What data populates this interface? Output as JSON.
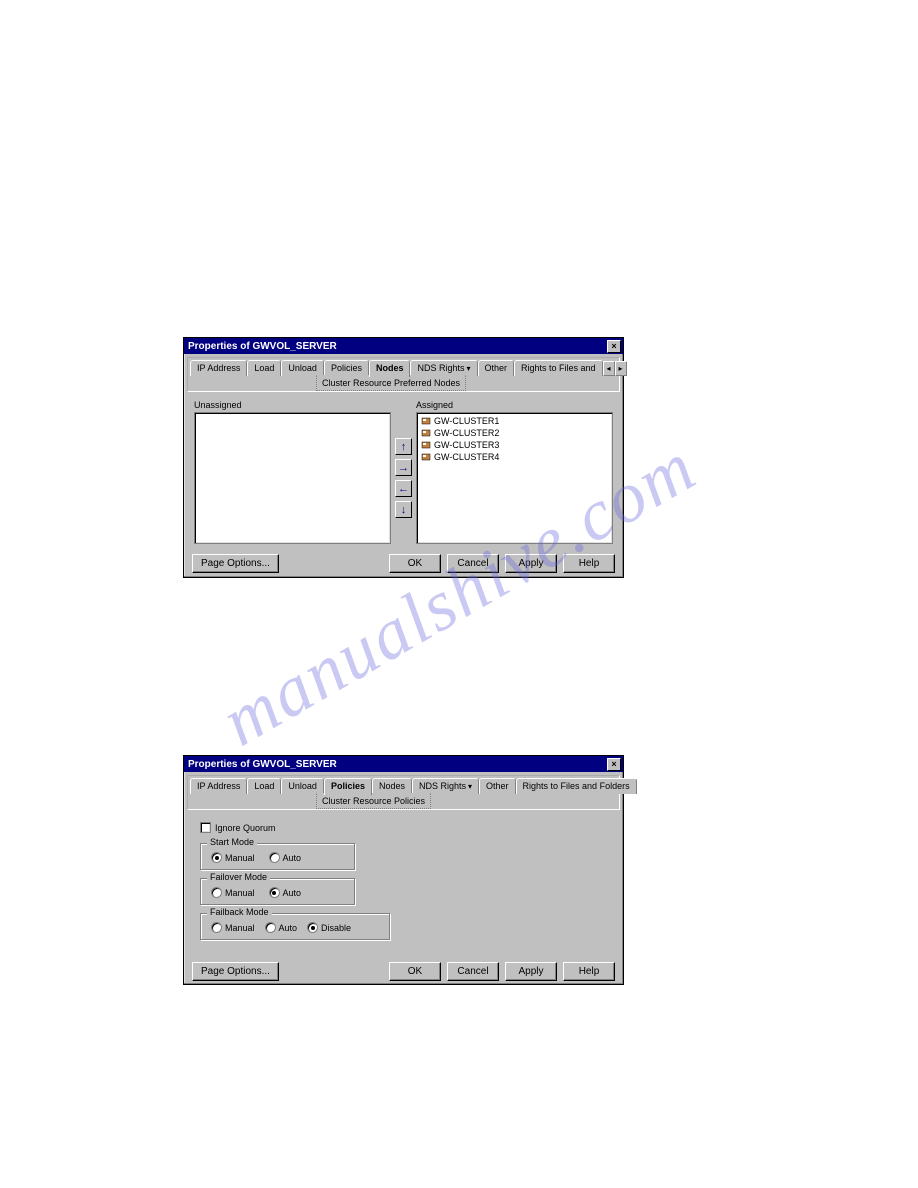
{
  "watermark": "manualshive.com",
  "dialog1": {
    "title": "Properties of GWVOL_SERVER",
    "tabs": [
      "IP Address",
      "Load",
      "Unload",
      "Policies",
      "Nodes",
      "NDS Rights",
      "Other",
      "Rights to Files and"
    ],
    "active_tab": "Nodes",
    "subtab": "Cluster Resource Preferred Nodes",
    "unassigned_label": "Unassigned",
    "assigned_label": "Assigned",
    "assigned_items": [
      "GW-CLUSTER1",
      "GW-CLUSTER2",
      "GW-CLUSTER3",
      "GW-CLUSTER4"
    ],
    "buttons": {
      "page_options": "Page Options...",
      "ok": "OK",
      "cancel": "Cancel",
      "apply": "Apply",
      "help": "Help"
    }
  },
  "dialog2": {
    "title": "Properties of GWVOL_SERVER",
    "tabs": [
      "IP Address",
      "Load",
      "Unload",
      "Policies",
      "Nodes",
      "NDS Rights",
      "Other",
      "Rights to Files and Folders"
    ],
    "active_tab": "Policies",
    "subtab": "Cluster Resource Policies",
    "ignore_quorum": "Ignore Quorum",
    "fieldsets": {
      "start_mode": {
        "legend": "Start Mode",
        "options": [
          "Manual",
          "Auto"
        ],
        "selected": "Manual"
      },
      "failover_mode": {
        "legend": "Failover Mode",
        "options": [
          "Manual",
          "Auto"
        ],
        "selected": "Auto"
      },
      "failback_mode": {
        "legend": "Failback Mode",
        "options": [
          "Manual",
          "Auto",
          "Disable"
        ],
        "selected": "Disable"
      }
    },
    "buttons": {
      "page_options": "Page Options...",
      "ok": "OK",
      "cancel": "Cancel",
      "apply": "Apply",
      "help": "Help"
    }
  }
}
